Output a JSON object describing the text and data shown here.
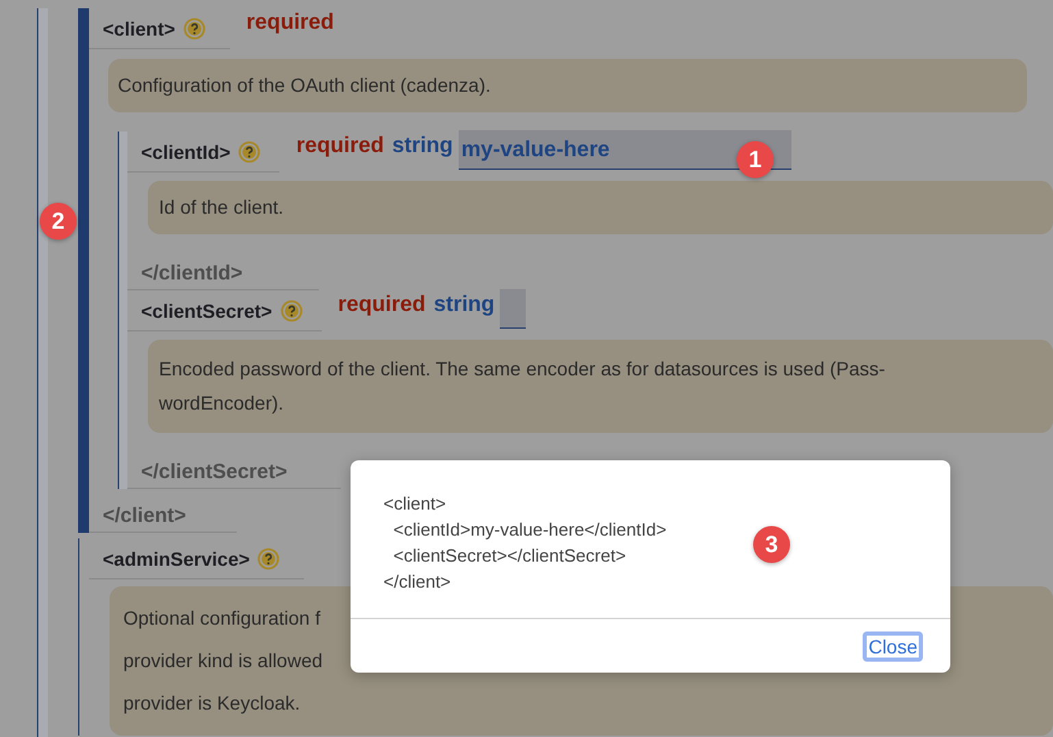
{
  "elements": [
    {
      "open_tag": "<client>",
      "badges": [
        {
          "kind": "required",
          "text": "required"
        }
      ],
      "description": [
        "Configuration of the OAuth client (cadenza)."
      ],
      "close_tag": "</client>",
      "children": [
        {
          "open_tag": "<clientId>",
          "badges": [
            {
              "kind": "required",
              "text": "required"
            },
            {
              "kind": "type",
              "text": "string"
            }
          ],
          "field": {
            "kind": "filled",
            "value": "my-value-here"
          },
          "description": [
            "Id of the client."
          ],
          "close_tag": "</clientId>"
        },
        {
          "open_tag": "<clientSecret>",
          "badges": [
            {
              "kind": "required",
              "text": "required"
            },
            {
              "kind": "type",
              "text": "string"
            }
          ],
          "field": {
            "kind": "empty"
          },
          "description": [
            "Encoded password of the client. The same encoder as for datasources is used (Pass-",
            "wordEncoder)."
          ],
          "close_tag": "</clientSecret>"
        }
      ]
    },
    {
      "open_tag": "<adminService>",
      "description": [
        "Optional configuration f",
        "provider kind is allowed",
        "provider is Keycloak."
      ]
    }
  ],
  "dialog": {
    "lines": [
      "<client>",
      "  <clientId>my-value-here</clientId>",
      "  <clientSecret></clientSecret>",
      "</client>"
    ],
    "close_button": "Close"
  },
  "markers": [
    {
      "text": "1"
    },
    {
      "text": "2"
    },
    {
      "text": "3"
    }
  ]
}
